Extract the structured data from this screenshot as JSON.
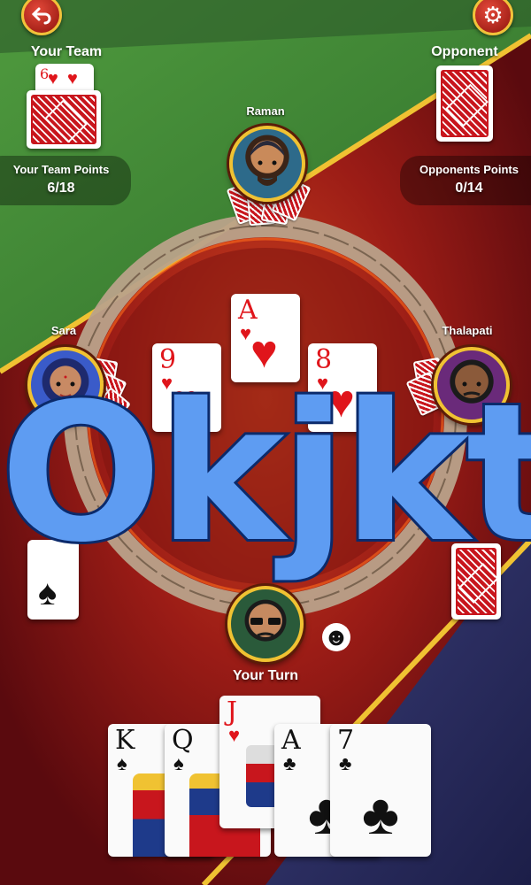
{
  "colors": {
    "accent_gold": "#f0c232",
    "table_red": "#8e1414",
    "table_green": "#3f8c3a",
    "overlay_blue": "#5e9cf2"
  },
  "icons": {
    "back": "back-arrow-icon",
    "settings": "gear-icon",
    "emoji": "smiley-icon"
  },
  "your_team": {
    "label": "Your Team",
    "card_rank": "6",
    "card_suit": "♥",
    "points_label": "Your Team Points",
    "points_value": "6/18"
  },
  "opponent": {
    "label": "Opponent",
    "points_label": "Opponents Points",
    "points_value": "0/14"
  },
  "players": {
    "top": "Raman",
    "left": "Sara",
    "right": "Thalapati"
  },
  "table_cards": [
    {
      "rank": "A",
      "suit": "♥"
    },
    {
      "rank": "9",
      "suit": "♥"
    },
    {
      "rank": "8",
      "suit": "♥"
    }
  ],
  "left_card": {
    "suit": "♠"
  },
  "turn_label": "Your Turn",
  "hand": [
    {
      "rank": "K",
      "suit": "♠"
    },
    {
      "rank": "Q",
      "suit": "♠"
    },
    {
      "rank": "J",
      "suit": "♥"
    },
    {
      "rank": "A",
      "suit": "♣"
    },
    {
      "rank": "7",
      "suit": "♣"
    }
  ],
  "overlay": "Okjkt"
}
